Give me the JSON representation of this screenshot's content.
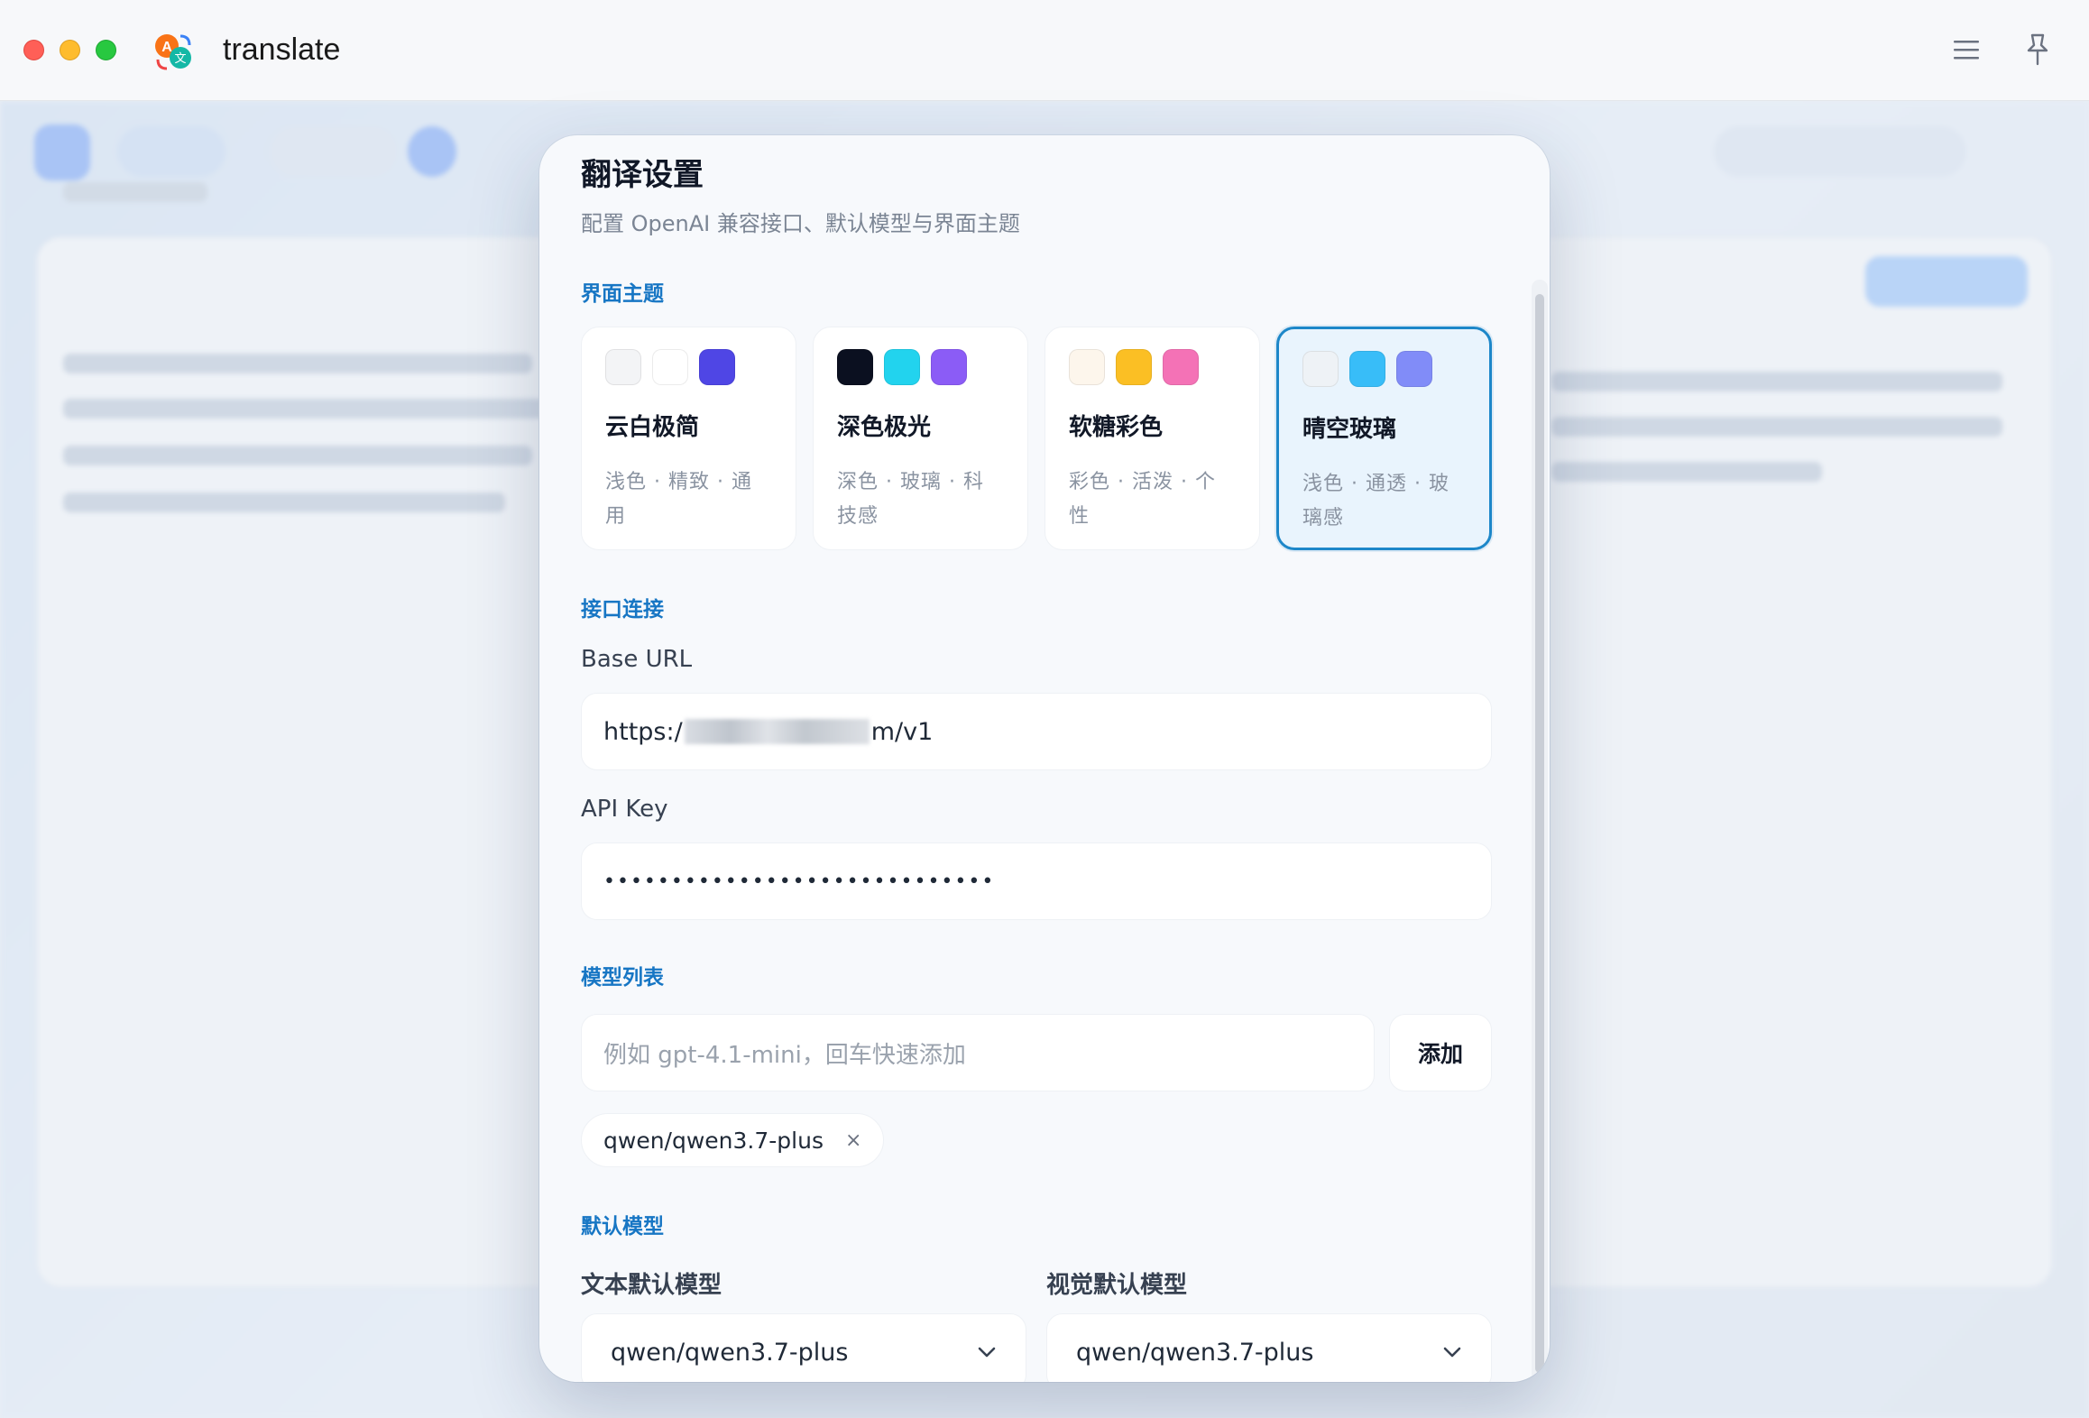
{
  "window": {
    "title": "translate"
  },
  "dialog": {
    "title": "翻译设置",
    "subtitle": "配置 OpenAI 兼容接口、默认模型与界面主题",
    "sections": {
      "theme": "界面主题",
      "api": "接口连接",
      "models": "模型列表",
      "defaults": "默认模型"
    },
    "themes": [
      {
        "name": "云白极简",
        "desc": "浅色 · 精致 · 通用",
        "swatches": [
          "#f3f4f6",
          "#ffffff",
          "#4f46e5"
        ],
        "active": false
      },
      {
        "name": "深色极光",
        "desc": "深色 · 玻璃 · 科技感",
        "swatches": [
          "#0b1020",
          "#22d3ee",
          "#8b5cf6"
        ],
        "active": false
      },
      {
        "name": "软糖彩色",
        "desc": "彩色 · 活泼 · 个性",
        "swatches": [
          "#fdf6ec",
          "#fbbf24",
          "#f472b6"
        ],
        "active": false
      },
      {
        "name": "晴空玻璃",
        "desc": "浅色 · 通透 · 玻璃感",
        "swatches": [
          "#eef2f6",
          "#38bdf8",
          "#818cf8"
        ],
        "active": true
      }
    ],
    "base_url": {
      "label": "Base URL",
      "prefix": "https:/",
      "suffix": "m/v1"
    },
    "api_key": {
      "label": "API Key",
      "value": "•••••••••••••••••••••••••••••"
    },
    "model_input": {
      "placeholder": "例如 gpt-4.1-mini，回车快速添加",
      "add_label": "添加"
    },
    "model_chips": [
      {
        "label": "qwen/qwen3.7-plus",
        "remove": "×"
      }
    ],
    "default_text": {
      "label": "文本默认模型",
      "value": "qwen/qwen3.7-plus"
    },
    "default_vision": {
      "label": "视觉默认模型",
      "value": "qwen/qwen3.7-plus"
    }
  },
  "colors": {
    "accent": "#1d87c9",
    "section": "#1776c4"
  }
}
